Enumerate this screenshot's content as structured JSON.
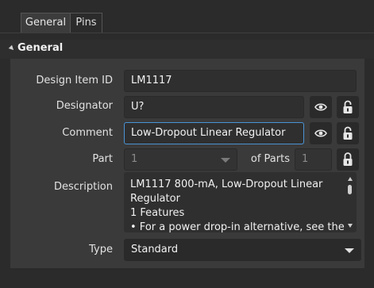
{
  "tabs": [
    {
      "label": "General"
    },
    {
      "label": "Pins"
    }
  ],
  "section": {
    "title": "General"
  },
  "fields": {
    "design_item_id": {
      "label": "Design Item ID",
      "value": "LM1117"
    },
    "designator": {
      "label": "Designator",
      "value": "U?"
    },
    "comment": {
      "label": "Comment",
      "value": "Low-Dropout Linear Regulator"
    },
    "part": {
      "label": "Part",
      "value": "1",
      "of_parts_label": "of Parts",
      "of_parts_value": "1"
    },
    "description": {
      "label": "Description",
      "lines": [
        "LM1117 800-mA, Low-Dropout Linear",
        "Regulator",
        "1 Features",
        "• For a power drop-in alternative, see the"
      ]
    },
    "type": {
      "label": "Type",
      "value": "Standard"
    }
  },
  "icons": {
    "visibility": "eye-icon",
    "lock": "lock-icon"
  },
  "colors": {
    "background": "#2b2b2b",
    "panel": "#3a3a3a",
    "field": "#2f2f2f",
    "focus_border": "#4a93d6"
  }
}
